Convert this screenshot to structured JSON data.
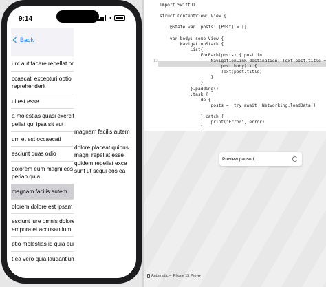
{
  "status": {
    "time": "9:14"
  },
  "nav": {
    "back_label": "Back"
  },
  "list_rows": [
    "unt aut facere repellat provi",
    "ccaecati excepturi optio",
    "reprehenderit",
    "ui est esse",
    "a molestias quasi exercitatio",
    "pellat qui ipsa sit aut",
    "um et est occaecati",
    "esciunt quas odio",
    "dolorem eum magni eos",
    "perian quia",
    "magnam facilis autem",
    "olorem dolore est ipsam",
    "esciunt iure omnis dolorem",
    "empora et accusantium",
    "ptio molestias id quia eum",
    "t ea vero quia laudantium"
  ],
  "detail": {
    "title": "magnam facilis autem",
    "body": [
      "dolore placeat quibus",
      "magni repellat esse",
      "quidem repellat exce",
      "sunt ut sequi eos ea"
    ]
  },
  "editor_lines": [
    {
      "n": "",
      "t": "import SwiftUI"
    },
    {
      "n": "",
      "t": ""
    },
    {
      "n": "",
      "t": "struct ContentView: View {"
    },
    {
      "n": "",
      "t": ""
    },
    {
      "n": "",
      "t": "    @State var  posts: [Post] = []"
    },
    {
      "n": "",
      "t": ""
    },
    {
      "n": "",
      "t": "    var body: some View {"
    },
    {
      "n": "",
      "t": "        NavigationStack {"
    },
    {
      "n": "",
      "t": "            List{"
    },
    {
      "n": "",
      "t": "                ForEach(posts) { post in"
    },
    {
      "n": "12",
      "t": "                    NavigationLink(destination: Text(post.title + \"\\n \""
    },
    {
      "n": "",
      "t": "                        post.body) ) {"
    },
    {
      "n": "",
      "t": "                        Text(post.title)"
    },
    {
      "n": "",
      "t": "                    }"
    },
    {
      "n": "",
      "t": "                }"
    },
    {
      "n": "",
      "t": "            }.padding()"
    },
    {
      "n": "",
      "t": "            .task {"
    },
    {
      "n": "",
      "t": "                do {"
    },
    {
      "n": "",
      "t": "                    posts =  try await  Networking.loadData()"
    },
    {
      "n": "",
      "t": ""
    },
    {
      "n": "",
      "t": "                } catch {"
    },
    {
      "n": "",
      "t": "                    print(\"Error\", error)"
    },
    {
      "n": "",
      "t": "                }"
    }
  ],
  "preview": {
    "paused_label": "Preview paused",
    "device_label": "Automatic – iPhone 15 Pro"
  }
}
